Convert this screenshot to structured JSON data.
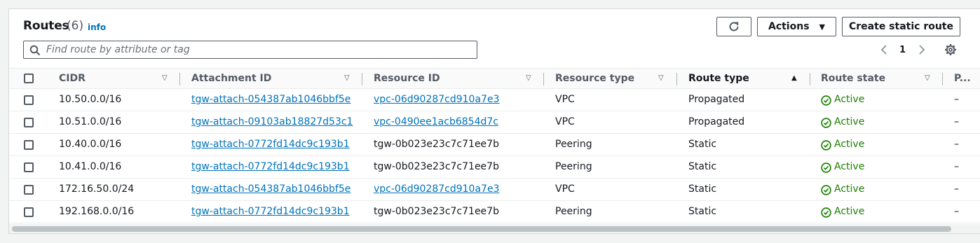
{
  "header": {
    "title": "Routes",
    "count": "(6)",
    "info": "info",
    "search_placeholder": "Find route by attribute or tag"
  },
  "toolbar": {
    "refresh_icon": "refresh-icon",
    "actions_label": "Actions",
    "create_label": "Create static route"
  },
  "pagination": {
    "prev": "‹",
    "page": "1",
    "next": "›"
  },
  "columns": [
    {
      "label": "CIDR",
      "sort": "none"
    },
    {
      "label": "Attachment ID",
      "sort": "none"
    },
    {
      "label": "Resource ID",
      "sort": "none"
    },
    {
      "label": "Resource type",
      "sort": "none"
    },
    {
      "label": "Route type",
      "sort": "ascending"
    },
    {
      "label": "Route state",
      "sort": "none"
    },
    {
      "label": "P..."
    }
  ],
  "rows": [
    {
      "cidr": "10.50.0.0/16",
      "attachment": "tgw-attach-054387ab1046bbf5e",
      "resource": "vpc-06d90287cd910a7e3",
      "resource_link": true,
      "type": "VPC",
      "route_type": "Propagated",
      "state": "Active",
      "p": "–"
    },
    {
      "cidr": "10.51.0.0/16",
      "attachment": "tgw-attach-09103ab18827d53c1",
      "resource": "vpc-0490ee1acb6854d7c",
      "resource_link": true,
      "type": "VPC",
      "route_type": "Propagated",
      "state": "Active",
      "p": "–"
    },
    {
      "cidr": "10.40.0.0/16",
      "attachment": "tgw-attach-0772fd14dc9c193b1",
      "resource": "tgw-0b023e23c7c71ee7b",
      "resource_link": false,
      "type": "Peering",
      "route_type": "Static",
      "state": "Active",
      "p": "–"
    },
    {
      "cidr": "10.41.0.0/16",
      "attachment": "tgw-attach-0772fd14dc9c193b1",
      "resource": "tgw-0b023e23c7c71ee7b",
      "resource_link": false,
      "type": "Peering",
      "route_type": "Static",
      "state": "Active",
      "p": "–"
    },
    {
      "cidr": "172.16.50.0/24",
      "attachment": "tgw-attach-054387ab1046bbf5e",
      "resource": "vpc-06d90287cd910a7e3",
      "resource_link": true,
      "type": "VPC",
      "route_type": "Static",
      "state": "Active",
      "p": "–"
    },
    {
      "cidr": "192.168.0.0/16",
      "attachment": "tgw-attach-0772fd14dc9c193b1",
      "resource": "tgw-0b023e23c7c71ee7b",
      "resource_link": false,
      "type": "Peering",
      "route_type": "Static",
      "state": "Active",
      "p": "–"
    }
  ],
  "colors": {
    "link": "#0073bb",
    "success": "#1d8102",
    "border": "#d5dbdb"
  }
}
